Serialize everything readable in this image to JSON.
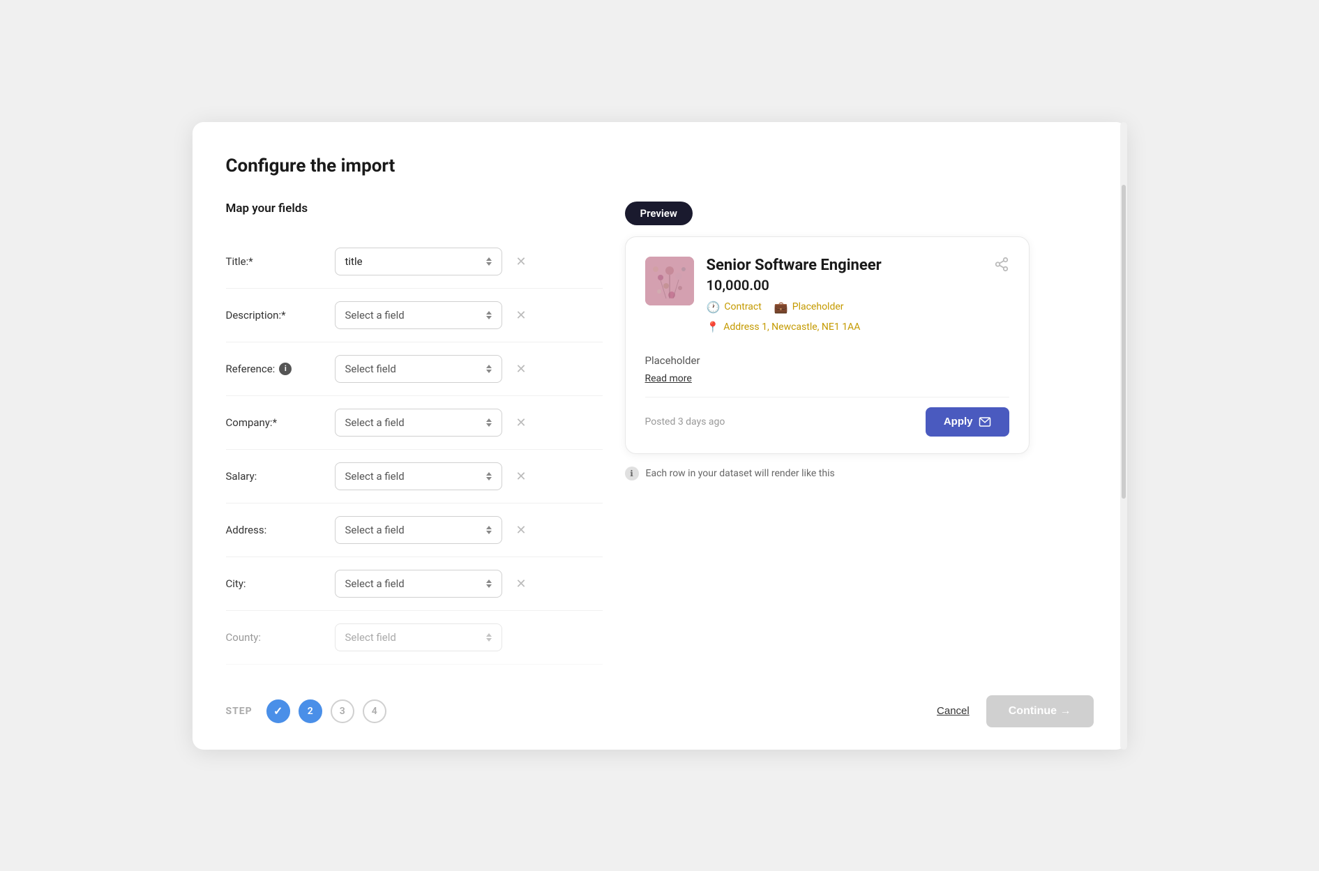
{
  "modal": {
    "title": "Configure the import"
  },
  "left": {
    "section_label": "Map your fields",
    "fields": [
      {
        "id": "title",
        "label": "Title:*",
        "value": "title",
        "has_value": true,
        "show_info": false
      },
      {
        "id": "description",
        "label": "Description:*",
        "value": "Select a field",
        "has_value": false,
        "show_info": false
      },
      {
        "id": "reference",
        "label": "Reference:",
        "value": "Select field",
        "has_value": false,
        "show_info": true
      },
      {
        "id": "company",
        "label": "Company:*",
        "value": "Select a field",
        "has_value": false,
        "show_info": false
      },
      {
        "id": "salary",
        "label": "Salary:",
        "value": "Select a field",
        "has_value": false,
        "show_info": false
      },
      {
        "id": "address",
        "label": "Address:",
        "value": "Select a field",
        "has_value": false,
        "show_info": false
      },
      {
        "id": "city",
        "label": "City:",
        "value": "Select a field",
        "has_value": false,
        "show_info": false
      },
      {
        "id": "extra",
        "label": "County:",
        "value": "Select field",
        "has_value": false,
        "show_info": false
      }
    ]
  },
  "preview": {
    "badge": "Preview",
    "job_title": "Senior Software Engineer",
    "salary": "10,000.00",
    "contract_tag": "Contract",
    "placeholder_tag": "Placeholder",
    "address": "Address 1, Newcastle, NE1 1AA",
    "description_placeholder": "Placeholder",
    "read_more": "Read more",
    "posted": "Posted 3 days ago",
    "apply_label": "Apply",
    "dataset_note": "Each row in your dataset will render like this"
  },
  "footer": {
    "step_label": "STEP",
    "steps": [
      {
        "number": "✓",
        "state": "done"
      },
      {
        "number": "2",
        "state": "active"
      },
      {
        "number": "3",
        "state": "default"
      },
      {
        "number": "4",
        "state": "default"
      }
    ],
    "cancel_label": "Cancel",
    "continue_label": "Continue →"
  }
}
